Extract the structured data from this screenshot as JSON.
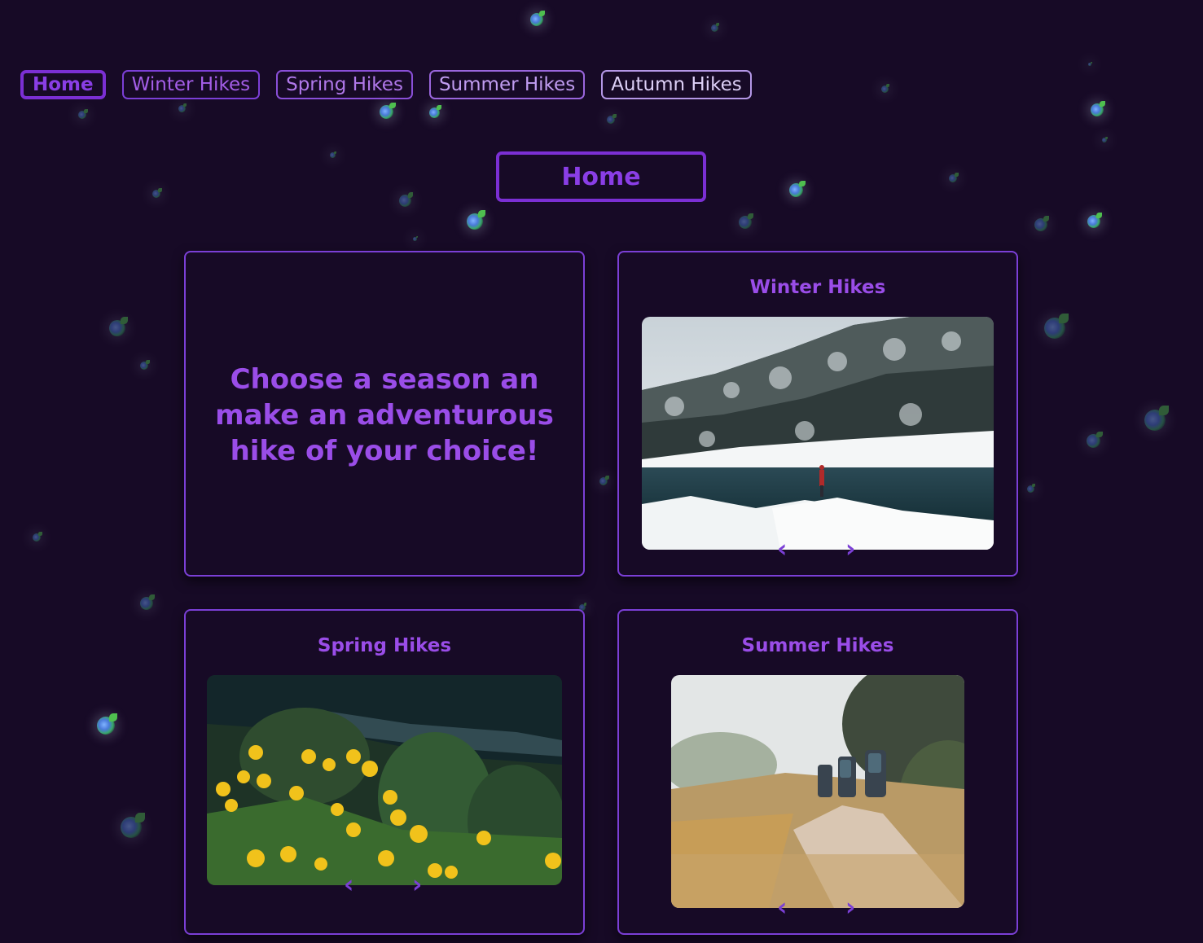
{
  "nav": {
    "items": [
      {
        "label": "Home",
        "active": true
      },
      {
        "label": "Winter Hikes"
      },
      {
        "label": "Spring Hikes"
      },
      {
        "label": "Summer Hikes"
      },
      {
        "label": "Autumn Hikes"
      }
    ]
  },
  "page": {
    "title": "Home"
  },
  "intro": {
    "text": "Choose a season an make an adventurous hike of your choice!"
  },
  "cards": {
    "winter": {
      "title": "Winter Hikes",
      "prev": "‹",
      "next": "›"
    },
    "spring": {
      "title": "Spring Hikes",
      "prev": "‹",
      "next": "›"
    },
    "summer": {
      "title": "Summer Hikes",
      "prev": "‹",
      "next": "›"
    }
  },
  "colors": {
    "background": "#170a26",
    "accent": "#7b2fd4",
    "text_accent": "#9a4de8"
  }
}
